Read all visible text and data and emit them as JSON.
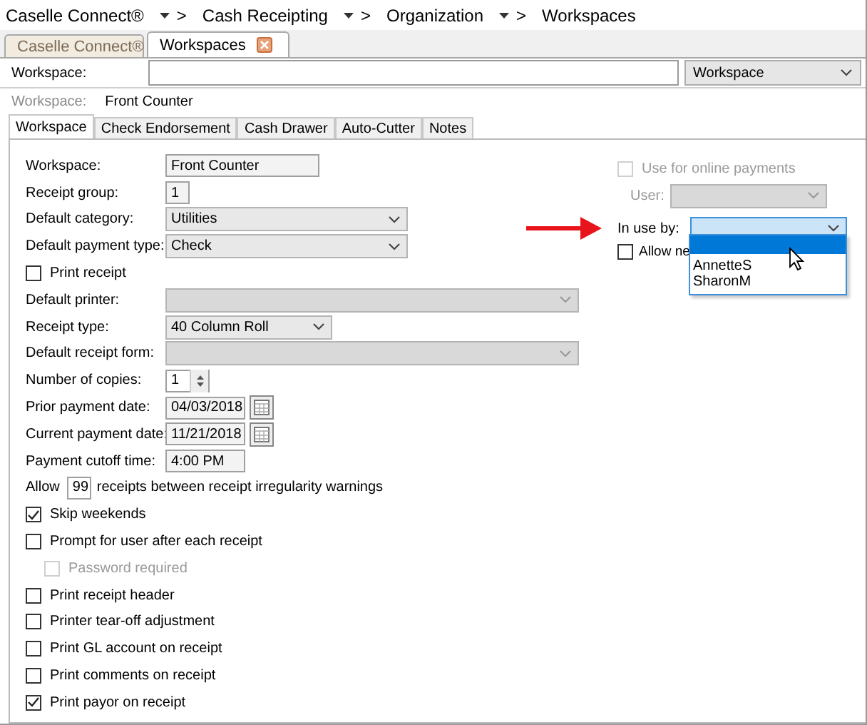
{
  "breadcrumb": [
    {
      "label": "Caselle Connect®",
      "separator": ">"
    },
    {
      "label": "Cash Receipting",
      "separator": ">"
    },
    {
      "label": "Organization",
      "separator": ">"
    },
    {
      "label": "Workspaces"
    }
  ],
  "document_tabs": [
    {
      "label": "Caselle Connect®",
      "selected": false
    },
    {
      "label": "Workspaces",
      "selected": true
    }
  ],
  "search": {
    "label": "Workspace:",
    "scope": "Workspace"
  },
  "record": {
    "label": "Workspace:",
    "value": "Front Counter"
  },
  "tabs": [
    {
      "label": "Workspace",
      "selected": true
    },
    {
      "label": "Check Endorsement",
      "selected": false
    },
    {
      "label": "Cash Drawer",
      "selected": false
    },
    {
      "label": "Auto-Cutter",
      "selected": false
    },
    {
      "label": "Notes",
      "selected": false
    }
  ],
  "fields": [
    {
      "kind": "textbox",
      "label": "Workspace:",
      "value": "Front Counter"
    },
    {
      "kind": "numberbox",
      "label": "Receipt group:",
      "value": "1"
    },
    {
      "kind": "dropdown",
      "label": "Default category:",
      "value": "Utilities",
      "disabled": false
    },
    {
      "kind": "dropdown",
      "label": "Default payment type:",
      "value": "Check",
      "disabled": false
    },
    {
      "kind": "checkbox",
      "label": "Print receipt",
      "checked": false,
      "disabled": false
    },
    {
      "kind": "wide-dropdown",
      "label": "Default printer:",
      "disabled": true
    },
    {
      "kind": "compact-dropdown",
      "label": "Receipt type:",
      "value": "40 Column Roll",
      "disabled": false
    },
    {
      "kind": "wide-dropdown",
      "label": "Default receipt form:",
      "disabled": true
    },
    {
      "kind": "spinner",
      "label": "Number of copies:",
      "value": "1"
    },
    {
      "kind": "date",
      "label": "Prior payment date:",
      "value": "04/03/2018"
    },
    {
      "kind": "date",
      "label": "Current payment date:",
      "value": "11/21/2018"
    },
    {
      "kind": "time",
      "label": "Payment cutoff time:",
      "value": "4:00 PM"
    },
    {
      "kind": "inline-number",
      "before": "Allow",
      "value": "99",
      "after": "receipts between receipt irregularity warnings"
    },
    {
      "kind": "checkbox",
      "label": "Skip weekends",
      "checked": true,
      "disabled": false
    },
    {
      "kind": "checkbox",
      "label": "Prompt for user after each receipt",
      "checked": false,
      "disabled": false,
      "children": [
        {
          "kind": "checkbox",
          "label": "Password required",
          "checked": false,
          "disabled": true
        }
      ]
    },
    {
      "kind": "checkbox",
      "label": "Print receipt header",
      "checked": false,
      "disabled": false
    },
    {
      "kind": "checkbox",
      "label": "Printer tear-off adjustment",
      "checked": false,
      "disabled": false
    },
    {
      "kind": "checkbox",
      "label": "Print GL account on receipt",
      "checked": false,
      "disabled": false
    },
    {
      "kind": "checkbox",
      "label": "Print comments on receipt",
      "checked": false,
      "disabled": false
    },
    {
      "kind": "checkbox",
      "label": "Print payor on receipt",
      "checked": true,
      "disabled": false
    }
  ],
  "online_payments": {
    "label": "Use for online payments",
    "checked": false,
    "disabled": true
  },
  "user": {
    "label": "User:",
    "disabled": true
  },
  "in_use_by": {
    "label": "In use by:",
    "open": true,
    "blank_option_selected": true,
    "options": [
      {
        "label": "AnnetteS",
        "selected": false
      },
      {
        "label": "SharonM",
        "selected": false
      }
    ]
  },
  "allow_new": {
    "label": "Allow ne",
    "checked": false
  }
}
